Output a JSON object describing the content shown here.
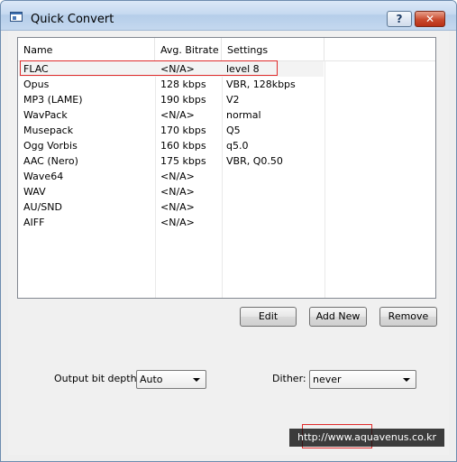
{
  "window": {
    "title": "Quick Convert",
    "help_label": "?",
    "close_label": "✕"
  },
  "list": {
    "columns": [
      "Name",
      "Avg. Bitrate",
      "Settings"
    ],
    "rows": [
      {
        "name": "FLAC",
        "bitrate": "<N/A>",
        "settings": "level 8"
      },
      {
        "name": "Opus",
        "bitrate": "128 kbps",
        "settings": "VBR, 128kbps"
      },
      {
        "name": "MP3 (LAME)",
        "bitrate": "190 kbps",
        "settings": "V2"
      },
      {
        "name": "WavPack",
        "bitrate": "<N/A>",
        "settings": "normal"
      },
      {
        "name": "Musepack",
        "bitrate": "170 kbps",
        "settings": "Q5"
      },
      {
        "name": "Ogg Vorbis",
        "bitrate": "160 kbps",
        "settings": "q5.0"
      },
      {
        "name": "AAC (Nero)",
        "bitrate": "175 kbps",
        "settings": "VBR, Q0.50"
      },
      {
        "name": "Wave64",
        "bitrate": "<N/A>",
        "settings": ""
      },
      {
        "name": "WAV",
        "bitrate": "<N/A>",
        "settings": ""
      },
      {
        "name": "AU/SND",
        "bitrate": "<N/A>",
        "settings": ""
      },
      {
        "name": "AIFF",
        "bitrate": "<N/A>",
        "settings": ""
      }
    ]
  },
  "buttons": {
    "edit": "Edit",
    "add_new": "Add New",
    "remove": "Remove"
  },
  "options": {
    "bit_depth_label": "Output bit depth:",
    "bit_depth_value": "Auto",
    "dither_label": "Dither:",
    "dither_value": "never"
  },
  "watermark": "http://www.aquavenus.co.kr"
}
